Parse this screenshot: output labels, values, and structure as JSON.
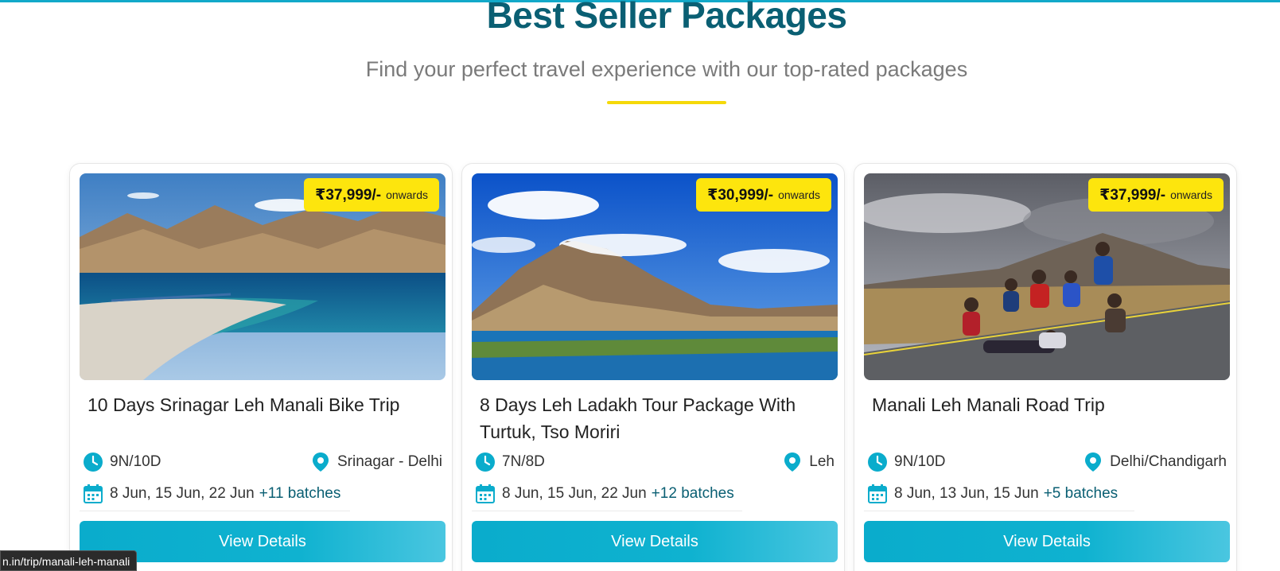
{
  "section": {
    "title": "Best Seller Packages",
    "subtitle": "Find your perfect travel experience with our top-rated packages"
  },
  "colors": {
    "accent": "#0aaccc",
    "heading": "#0a5f73",
    "badge": "#fde50d",
    "underline": "#f5d90a"
  },
  "icons": {
    "duration": "clock-icon",
    "location": "map-pin-icon",
    "dates": "calendar-icon"
  },
  "cards": [
    {
      "price": "₹37,999/-",
      "price_suffix": "onwards",
      "title": "10 Days Srinagar Leh Manali Bike Trip",
      "duration": "9N/10D",
      "location": "Srinagar - Delhi",
      "dates": "8 Jun, 15 Jun, 22 Jun",
      "batches": "+11 batches",
      "cta": "View Details"
    },
    {
      "price": "₹30,999/-",
      "price_suffix": "onwards",
      "title": "8 Days Leh Ladakh Tour Package With Turtuk, Tso Moriri",
      "duration": "7N/8D",
      "location": "Leh",
      "dates": "8 Jun, 15 Jun, 22 Jun",
      "batches": "+12 batches",
      "cta": "View Details"
    },
    {
      "price": "₹37,999/-",
      "price_suffix": "onwards",
      "title": "Manali Leh Manali Road Trip",
      "duration": "9N/10D",
      "location": "Delhi/Chandigarh",
      "dates": "8 Jun, 13 Jun, 15 Jun",
      "batches": "+5 batches",
      "cta": "View Details"
    }
  ],
  "status_bar": {
    "url": "n.in/trip/manali-leh-manali"
  }
}
